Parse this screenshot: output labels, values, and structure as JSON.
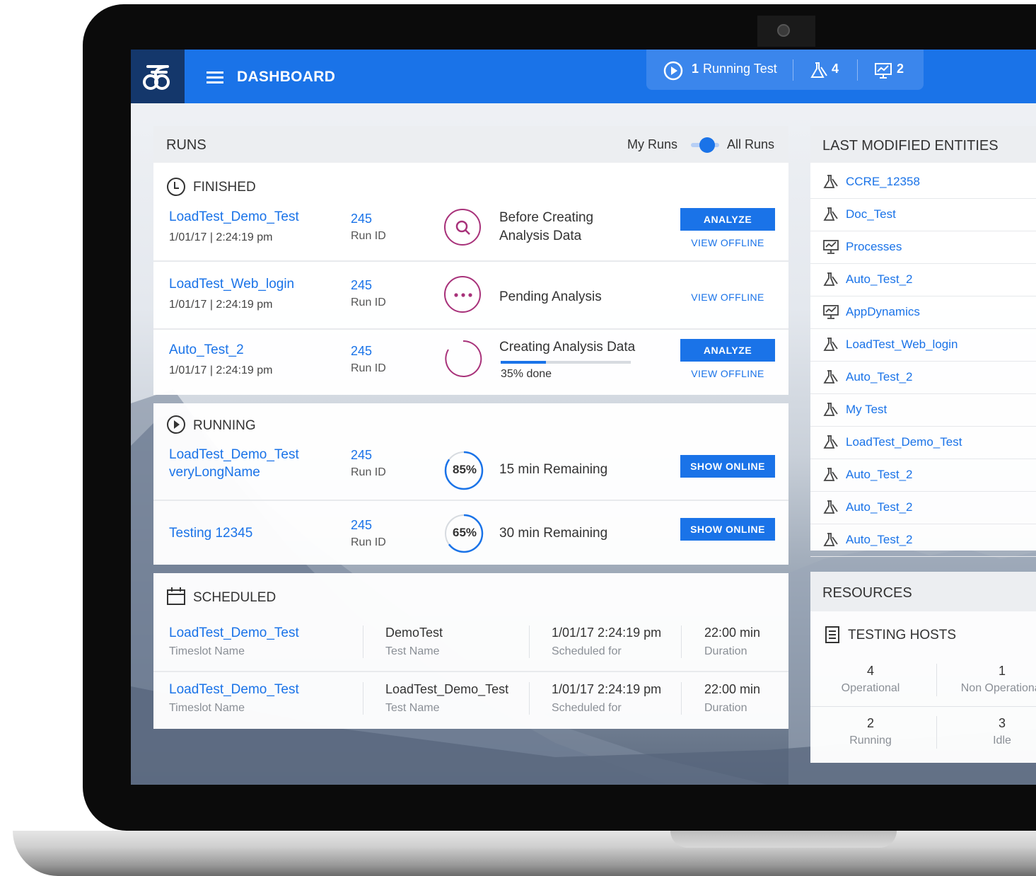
{
  "header": {
    "title": "DASHBOARD",
    "running_count": "1",
    "running_label": "Running Test",
    "tests_count": "4",
    "monitors_count": "2"
  },
  "runs": {
    "title": "RUNS",
    "toggle_left": "My Runs",
    "toggle_right": "All Runs",
    "finished": {
      "title": "FINISHED",
      "rows": [
        {
          "name": "LoadTest_Demo_Test",
          "date": "1/01/17 | 2:24:19 pm",
          "run_id": "245",
          "run_id_label": "Run ID",
          "status_line1": "Before Creating",
          "status_line2": "Analysis Data",
          "analyze": "ANALYZE",
          "view_offline": "VIEW OFFLINE"
        },
        {
          "name": "LoadTest_Web_login",
          "date": "1/01/17 | 2:24:19 pm",
          "run_id": "245",
          "run_id_label": "Run ID",
          "status_line1": "Pending Analysis",
          "view_offline": "VIEW OFFLINE"
        },
        {
          "name": "Auto_Test_2",
          "date": "1/01/17 | 2:24:19 pm",
          "run_id": "245",
          "run_id_label": "Run ID",
          "status_line1": "Creating Analysis Data",
          "progress_text": "35% done",
          "progress": 0.35,
          "analyze": "ANALYZE",
          "view_offline": "VIEW OFFLINE"
        }
      ]
    },
    "running": {
      "title": "RUNNING",
      "rows": [
        {
          "name_line1": "LoadTest_Demo_Test",
          "name_line2": "veryLongName",
          "run_id": "245",
          "run_id_label": "Run ID",
          "percent": "85%",
          "remaining": "15 min Remaining",
          "button": "SHOW ONLINE"
        },
        {
          "name_line1": "Testing 12345",
          "run_id": "245",
          "run_id_label": "Run ID",
          "percent": "65%",
          "remaining": "30 min Remaining",
          "button": "SHOW ONLINE"
        }
      ]
    },
    "scheduled": {
      "title": "SCHEDULED",
      "rows": [
        {
          "name": "LoadTest_Demo_Test",
          "name_label": "Timeslot Name",
          "test": "DemoTest",
          "test_label": "Test Name",
          "time": "1/01/17  2:24:19 pm",
          "time_label": "Scheduled for",
          "duration": "22:00 min",
          "duration_label": "Duration"
        },
        {
          "name": "LoadTest_Demo_Test",
          "name_label": "Timeslot Name",
          "test": "LoadTest_Demo_Test",
          "test_label": "Test Name",
          "time": "1/01/17  2:24:19 pm",
          "time_label": "Scheduled for",
          "duration": "22:00 min",
          "duration_label": "Duration"
        }
      ]
    }
  },
  "entities": {
    "title": "LAST MODIFIED ENTITIES",
    "items": [
      {
        "label": "CCRE_12358",
        "icon": "flask-icon"
      },
      {
        "label": "Doc_Test",
        "icon": "flask-icon"
      },
      {
        "label": "Processes",
        "icon": "monitor-icon"
      },
      {
        "label": "Auto_Test_2",
        "icon": "flask-icon"
      },
      {
        "label": "AppDynamics",
        "icon": "monitor-icon"
      },
      {
        "label": "LoadTest_Web_login",
        "icon": "flask-icon"
      },
      {
        "label": "Auto_Test_2",
        "icon": "flask-icon"
      },
      {
        "label": "My Test",
        "icon": "flask-icon"
      },
      {
        "label": "LoadTest_Demo_Test",
        "icon": "flask-icon"
      },
      {
        "label": "Auto_Test_2",
        "icon": "flask-icon"
      },
      {
        "label": "Auto_Test_2",
        "icon": "flask-icon"
      },
      {
        "label": "Auto_Test_2",
        "icon": "flask-icon"
      }
    ]
  },
  "resources": {
    "title": "RESOURCES",
    "subtitle": "TESTING HOSTS",
    "stats": [
      {
        "value": "4",
        "label": "Operational"
      },
      {
        "value": "1",
        "label": "Non Operational"
      },
      {
        "value": "2",
        "label": "Running"
      },
      {
        "value": "3",
        "label": "Idle"
      }
    ]
  },
  "colors": {
    "accent": "#1a73e8",
    "brand_dark": "#14376b",
    "status_magenta": "#a8327a"
  }
}
